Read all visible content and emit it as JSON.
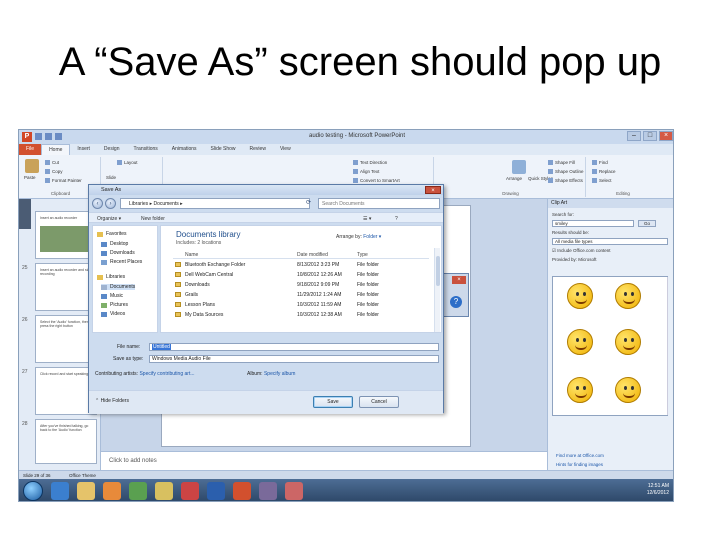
{
  "slide": {
    "title": "A “Save As” screen should pop up"
  },
  "app": {
    "title": "audio testing - Microsoft PowerPoint",
    "icon_letter": "P",
    "tabs": [
      "File",
      "Home",
      "Insert",
      "Design",
      "Transitions",
      "Animations",
      "Slide Show",
      "Review",
      "View"
    ],
    "ribbon": {
      "clipboard": {
        "label": "Clipboard",
        "cut": "Cut",
        "copy": "Copy",
        "format_painter": "Format Painter",
        "paste": "Paste"
      },
      "slides": {
        "layout": "Layout",
        "new_slide": "Slide",
        "reset": "Reset"
      },
      "paragraph": {
        "text_direction": "Text Direction",
        "align_text": "Align Text",
        "convert": "Convert to SmartArt"
      },
      "drawing": {
        "label": "Drawing",
        "arrange": "Arrange",
        "quick_styles": "Quick Styles",
        "shape_fill": "Shape Fill",
        "shape_outline": "Shape Outline",
        "shape_effects": "Shape Effects"
      },
      "editing": {
        "label": "Editing",
        "find": "Find",
        "replace": "Replace",
        "select": "Select"
      }
    },
    "thumbnails": [
      {
        "num": "",
        "text": "Insert an audio recorder"
      },
      {
        "num": "25",
        "text": "Insert an audio recorder and start recording"
      },
      {
        "num": "26",
        "text": "Select the 'Audio' function, then press the right button"
      },
      {
        "num": "27",
        "text": "Click record and start speaking"
      },
      {
        "num": "28",
        "text": "After you've finished talking, go back to the 'Audio' function"
      }
    ],
    "slide_fragment": [
      "the",
      "g"
    ],
    "notes_placeholder": "Click to add notes",
    "status": {
      "slide": "Slide 29 of 36",
      "theme": "Office Theme"
    },
    "clock": {
      "time": "12:51 AM",
      "date": "12/6/2012"
    }
  },
  "clipart": {
    "title": "Clip Art",
    "search_for_label": "Search for:",
    "search_value": "smiley",
    "go_label": "Go",
    "results_label": "Results should be:",
    "results_value": "All media file types",
    "include_office": "Include Office.com content",
    "provided_by": "Provided by:",
    "provider": "Microsoft",
    "link_more": "Find more at Office.com",
    "link_hints": "Hints for finding images"
  },
  "dialog": {
    "title": "Save As",
    "address": "Libraries ▸ Documents ▸",
    "search_placeholder": "Search Documents",
    "toolbar": {
      "organize": "Organize ▾",
      "new_folder": "New folder"
    },
    "nav": [
      {
        "label": "Favorites",
        "color": "#e6c050"
      },
      {
        "label": "Desktop",
        "color": "#5a89c8"
      },
      {
        "label": "Downloads",
        "color": "#5a89c8"
      },
      {
        "label": "Recent Places",
        "color": "#7aa0d0"
      },
      {
        "label": "Libraries",
        "color": "#e6c050"
      },
      {
        "label": "Documents",
        "color": "#c9d4e4"
      },
      {
        "label": "Music",
        "color": "#5a89c8"
      },
      {
        "label": "Pictures",
        "color": "#7fb06a"
      },
      {
        "label": "Videos",
        "color": "#5a89c8"
      }
    ],
    "library_title": "Documents library",
    "library_includes": "Includes: 2 locations",
    "arrange_by": "Arrange by:",
    "arrange_value": "Folder ▾",
    "columns": {
      "name": "Name",
      "date": "Date modified",
      "type": "Type"
    },
    "files": [
      {
        "name": "Bluetooth Exchange Folder",
        "date": "8/13/2012 3:23 PM",
        "type": "File folder"
      },
      {
        "name": "Dell WebCam Central",
        "date": "10/8/2012 12:26 AM",
        "type": "File folder"
      },
      {
        "name": "Downloads",
        "date": "9/18/2012 9:09 PM",
        "type": "File folder"
      },
      {
        "name": "Grails",
        "date": "11/29/2012 1:24 AM",
        "type": "File folder"
      },
      {
        "name": "Lesson Plans",
        "date": "10/3/2012 11:59 AM",
        "type": "File folder"
      },
      {
        "name": "My Data Sources",
        "date": "10/3/2012 12:38 AM",
        "type": "File folder"
      }
    ],
    "file_name_label": "File name:",
    "file_name_value": "Untitled",
    "save_type_label": "Save as type:",
    "save_type_value": "Windows Media Audio File",
    "artists_label": "Contributing artists:",
    "artists_link": "Specify contributing art...",
    "album_label": "Album:",
    "album_link": "Specify album",
    "hide_folders": "Hide Folders",
    "save_button": "Save",
    "cancel_button": "Cancel"
  }
}
